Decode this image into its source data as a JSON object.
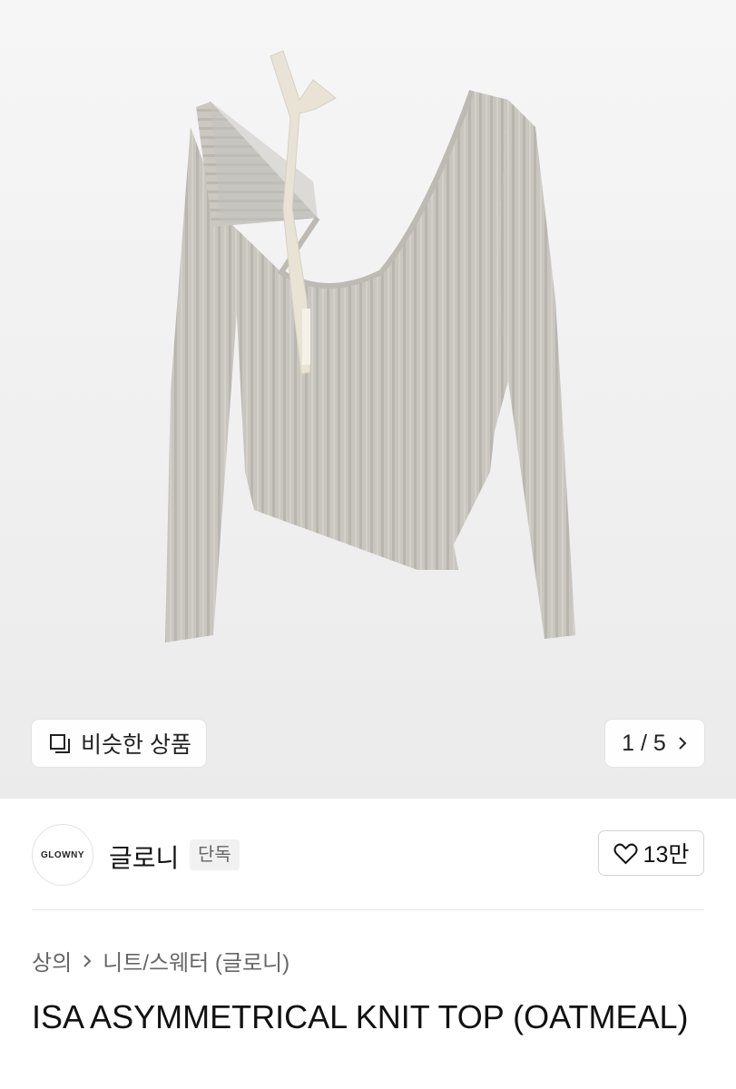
{
  "hero": {
    "image": "gray-ribbed-asymmetrical-knit-top-photo",
    "similar_label": "비슷한 상품",
    "similar_icon": "similar-items-icon",
    "pager_text": "1 / 5",
    "pager_icon": "chevron-right-icon"
  },
  "brand": {
    "logo_text": "GLOWNY",
    "name": "글로니",
    "badge": "단독",
    "like_icon": "heart-outline-icon",
    "like_count": "13만"
  },
  "breadcrumb": {
    "items": [
      "상의",
      "니트/스웨터 (글로니)"
    ]
  },
  "product": {
    "title": "ISA ASYMMETRICAL KNIT TOP (OATMEAL)"
  },
  "colors": {
    "hero_bg": "#eeeeee",
    "knit": "#c9c6c0",
    "ribbon": "#e9e3d6",
    "text": "#111111",
    "muted": "#666666"
  }
}
